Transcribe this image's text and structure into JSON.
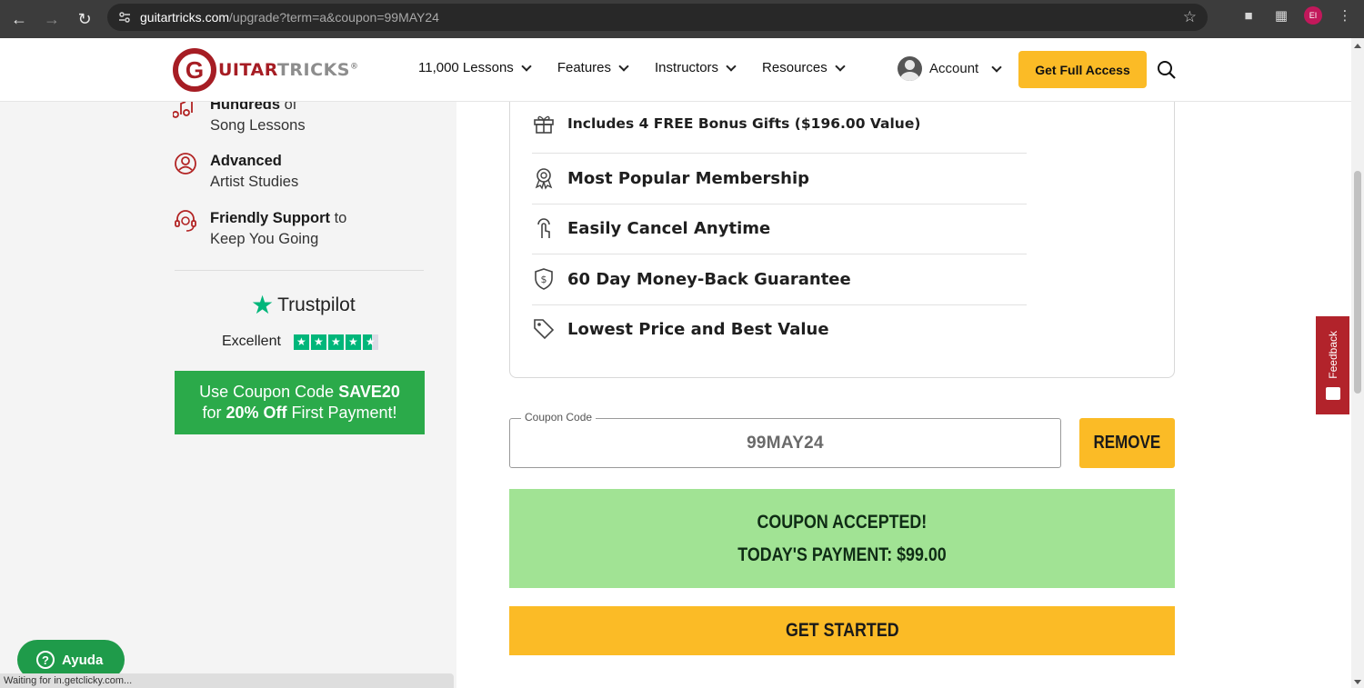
{
  "browser": {
    "url_host": "guitartricks.com",
    "url_rest": "/upgrade?term=a&coupon=99MAY24",
    "profile_initials": "EI"
  },
  "header": {
    "logo_letter": "G",
    "logo_text_red": "UITAR",
    "logo_text_gray": "TRICKS",
    "logo_mark": "®",
    "nav": [
      {
        "label": "11,000 Lessons"
      },
      {
        "label": "Features"
      },
      {
        "label": "Instructors"
      },
      {
        "label": "Resources"
      }
    ],
    "account_label": "Account",
    "cta_label": "Get Full Access"
  },
  "left_features": [
    {
      "bold": "Hundreds",
      "rest_inline": " of",
      "line2": "Song Lessons",
      "icon": "music-note-icon"
    },
    {
      "bold": "Advanced",
      "rest_inline": "",
      "line2": "Artist Studies",
      "icon": "user-circle-icon"
    },
    {
      "bold": "Friendly Support",
      "rest_inline": " to",
      "line2": "Keep You Going",
      "icon": "headset-icon"
    }
  ],
  "trustpilot": {
    "brand": "Trustpilot",
    "rating_label": "Excellent",
    "stars": 4.5
  },
  "coupon_banner": {
    "line1_prefix": "Use Coupon Code ",
    "line1_code": "SAVE20",
    "line2_prefix": "for ",
    "line2_bold": "20% Off",
    "line2_suffix": " First Payment!"
  },
  "benefits": [
    {
      "label": "Includes 4 FREE Bonus Gifts ($196.00 Value)",
      "icon": "gift-icon"
    },
    {
      "label": "Most Popular Membership",
      "icon": "award-icon"
    },
    {
      "label": "Easily Cancel Anytime",
      "icon": "pointer-hand-icon"
    },
    {
      "label": "60 Day Money-Back Guarantee",
      "icon": "shield-dollar-icon"
    },
    {
      "label": "Lowest Price and Best Value",
      "icon": "price-tag-icon"
    }
  ],
  "coupon": {
    "legend": "Coupon Code",
    "value": "99MAY24",
    "remove_label": "REMOVE"
  },
  "accepted": {
    "line1": "COUPON ACCEPTED!",
    "line2": "TODAY'S PAYMENT: $99.00"
  },
  "get_started_label": "GET STARTED",
  "feedback_label": "Feedback",
  "help_label": "Ayuda",
  "status_text": "Waiting for in.getclicky.com...",
  "colors": {
    "brand_red": "#a61d24",
    "cta_yellow": "#fbbb26",
    "success_green": "#a1e394",
    "banner_green": "#2baa4a"
  }
}
